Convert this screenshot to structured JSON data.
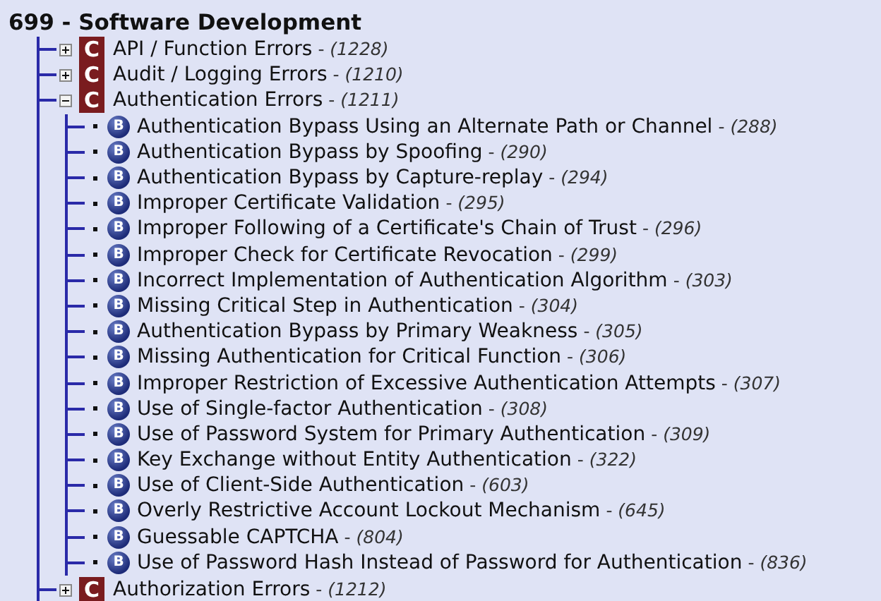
{
  "title": "699 - Software Development",
  "categories": [
    {
      "kind": "category",
      "badge": "C",
      "name": "API / Function Errors",
      "ref": "- *(1228)*",
      "expanded": false
    },
    {
      "kind": "category",
      "badge": "C",
      "name": "Audit / Logging Errors",
      "ref": "- *(1210)*",
      "expanded": false
    },
    {
      "kind": "category",
      "badge": "C",
      "name": "Authentication Errors",
      "ref": "- *(1211)*",
      "expanded": true,
      "children": [
        {
          "kind": "base",
          "badge": "B",
          "name": "Authentication Bypass Using an Alternate Path or Channel",
          "ref": "- *(288)*"
        },
        {
          "kind": "base",
          "badge": "B",
          "name": "Authentication Bypass by Spoofing",
          "ref": "- *(290)*"
        },
        {
          "kind": "base",
          "badge": "B",
          "name": "Authentication Bypass by Capture-replay",
          "ref": "- *(294)*"
        },
        {
          "kind": "base",
          "badge": "B",
          "name": "Improper Certificate Validation",
          "ref": "- *(295)*"
        },
        {
          "kind": "base",
          "badge": "B",
          "name": "Improper Following of a Certificate's Chain of Trust",
          "ref": "- *(296)*"
        },
        {
          "kind": "base",
          "badge": "B",
          "name": "Improper Check for Certificate Revocation",
          "ref": "- *(299)*"
        },
        {
          "kind": "base",
          "badge": "B",
          "name": "Incorrect Implementation of Authentication Algorithm",
          "ref": "- *(303)*"
        },
        {
          "kind": "base",
          "badge": "B",
          "name": "Missing Critical Step in Authentication",
          "ref": "- *(304)*"
        },
        {
          "kind": "base",
          "badge": "B",
          "name": "Authentication Bypass by Primary Weakness",
          "ref": "- *(305)*"
        },
        {
          "kind": "base",
          "badge": "B",
          "name": "Missing Authentication for Critical Function",
          "ref": "- *(306)*"
        },
        {
          "kind": "base",
          "badge": "B",
          "name": "Improper Restriction of Excessive Authentication Attempts",
          "ref": "- *(307)*"
        },
        {
          "kind": "base",
          "badge": "B",
          "name": "Use of Single-factor Authentication",
          "ref": "- *(308)*"
        },
        {
          "kind": "base",
          "badge": "B",
          "name": "Use of Password System for Primary Authentication",
          "ref": "- *(309)*"
        },
        {
          "kind": "base",
          "badge": "B",
          "name": "Key Exchange without Entity Authentication",
          "ref": "- *(322)*"
        },
        {
          "kind": "base",
          "badge": "B",
          "name": "Use of Client-Side Authentication",
          "ref": "- *(603)*"
        },
        {
          "kind": "base",
          "badge": "B",
          "name": "Overly Restrictive Account Lockout Mechanism",
          "ref": "- *(645)*"
        },
        {
          "kind": "base",
          "badge": "B",
          "name": "Guessable CAPTCHA",
          "ref": "- *(804)*"
        },
        {
          "kind": "base",
          "badge": "B",
          "name": "Use of Password Hash Instead of Password for Authentication",
          "ref": "- *(836)*"
        }
      ]
    },
    {
      "kind": "category",
      "badge": "C",
      "name": "Authorization Errors",
      "ref": "- *(1212)*",
      "expanded": false
    }
  ]
}
